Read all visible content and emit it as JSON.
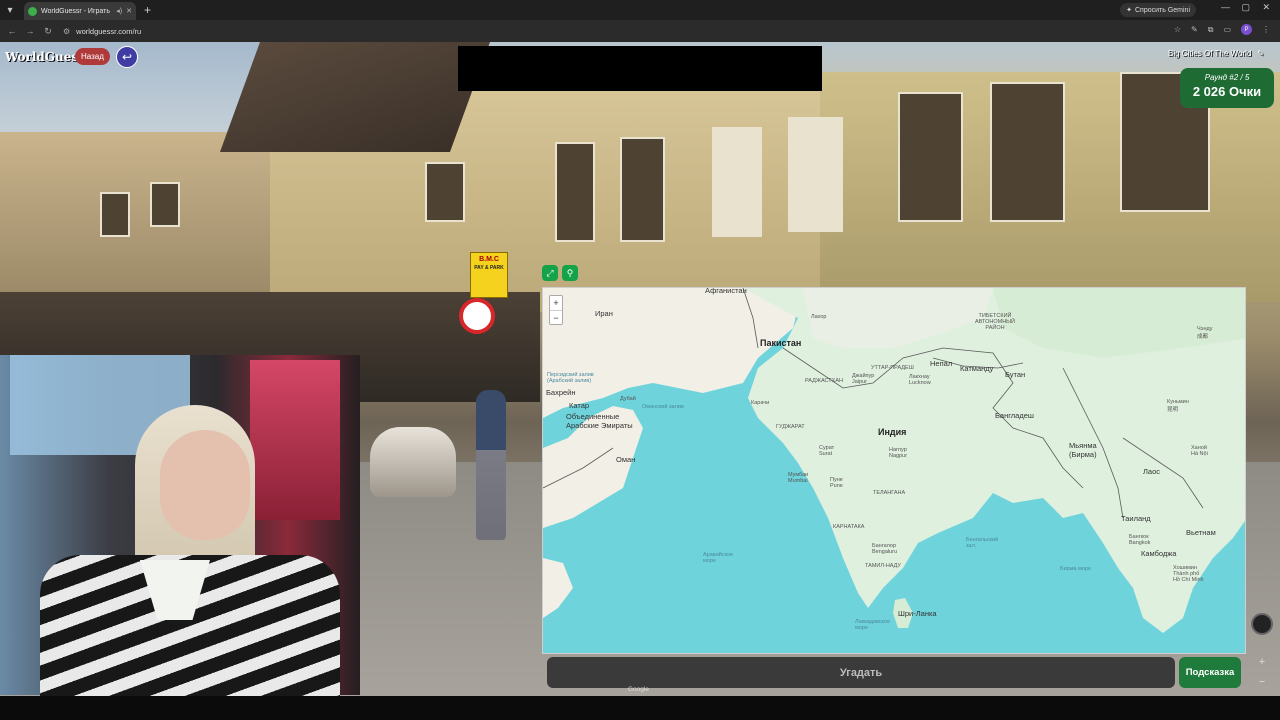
{
  "browser": {
    "tab_title": "WorldGuessr - Играть в Ge...",
    "url": "worldguessr.com/ru",
    "gemini_label": "Спросить Gemini",
    "profile_initial": "P"
  },
  "game": {
    "logo": "WorldGuessr",
    "back_label": "Назад",
    "map_name": "Big Cities Of The World",
    "round_label": "Раунд #2 / 5",
    "points_label": "2 026 Очки",
    "guess_label": "Угадать",
    "hint_label": "Подсказка",
    "google_label": "Google",
    "street_signs": {
      "bmc": "B.M.C",
      "pay_park": "PAY & PARK"
    }
  },
  "map": {
    "zoom_in": "+",
    "zoom_out": "−",
    "labels": {
      "afghanistan": "Афганистан",
      "iran": "Иран",
      "pakistan": "Пакистан",
      "india": "Индия",
      "nepal": "Непал",
      "kathmandu": "Катманду",
      "bhutan": "Бутан",
      "bangladesh": "Бангладеш",
      "myanmar": "Мьянма\n(Бирма)",
      "laos": "Лаос",
      "thailand": "Таиланд",
      "vietnam": "Вьетнам",
      "cambodia": "Камбоджа",
      "sri_lanka": "Шри-Ланка",
      "bahrain": "Бахрейн",
      "qatar": "Катар",
      "uae": "Объединенные\nАрабские Эмираты",
      "oman": "Оман",
      "dubai": "Дубай",
      "karachi": "Карачи",
      "lahore": "Лахор",
      "jaipur": "Джайпур\nJaipur",
      "lucknow": "Лакхнау\nLucknow",
      "mumbai": "Мумбаи\nMumbai",
      "pune": "Пуне\nPune",
      "nagpur": "Нагпур\nNagpur",
      "surat": "Сурат\nSurat",
      "bangalore": "Бангалор\nBengaluru",
      "bangkok": "Бангкок\nBangkok",
      "hanoi": "Ханой\nHà Nội",
      "kunming": "Куньмин\n昆明",
      "chengdu": "Чэнду\n成都",
      "arabian_sea": "Аравийское\nморе",
      "bay_of_bengal": "Бенгальский\nзал.",
      "andaman_sea": "Бирма море",
      "hcmc": "Хошимин\nThành phố\nHồ Chí Minh",
      "laccadive_sea": "Лаккадивское\nморе",
      "tibet": "ТИБЕТСКИЙ\nАВТОНОМНЫЙ\nРАЙОН",
      "rajasthan": "РАДЖАСТХАН",
      "gujarat": "ГУДЖАРАТ",
      "karnataka": "КАРНАТАКА",
      "telangana": "ТЕЛАНГАНА",
      "tamil_nadu": "ТАМИЛ-НАДУ",
      "uttar_pradesh": "УТТАР-ПРАДЕШ",
      "persian_gulf": "Персидский залив\n(Арабский залив)",
      "oman_gulf": "Оманский залив"
    }
  }
}
